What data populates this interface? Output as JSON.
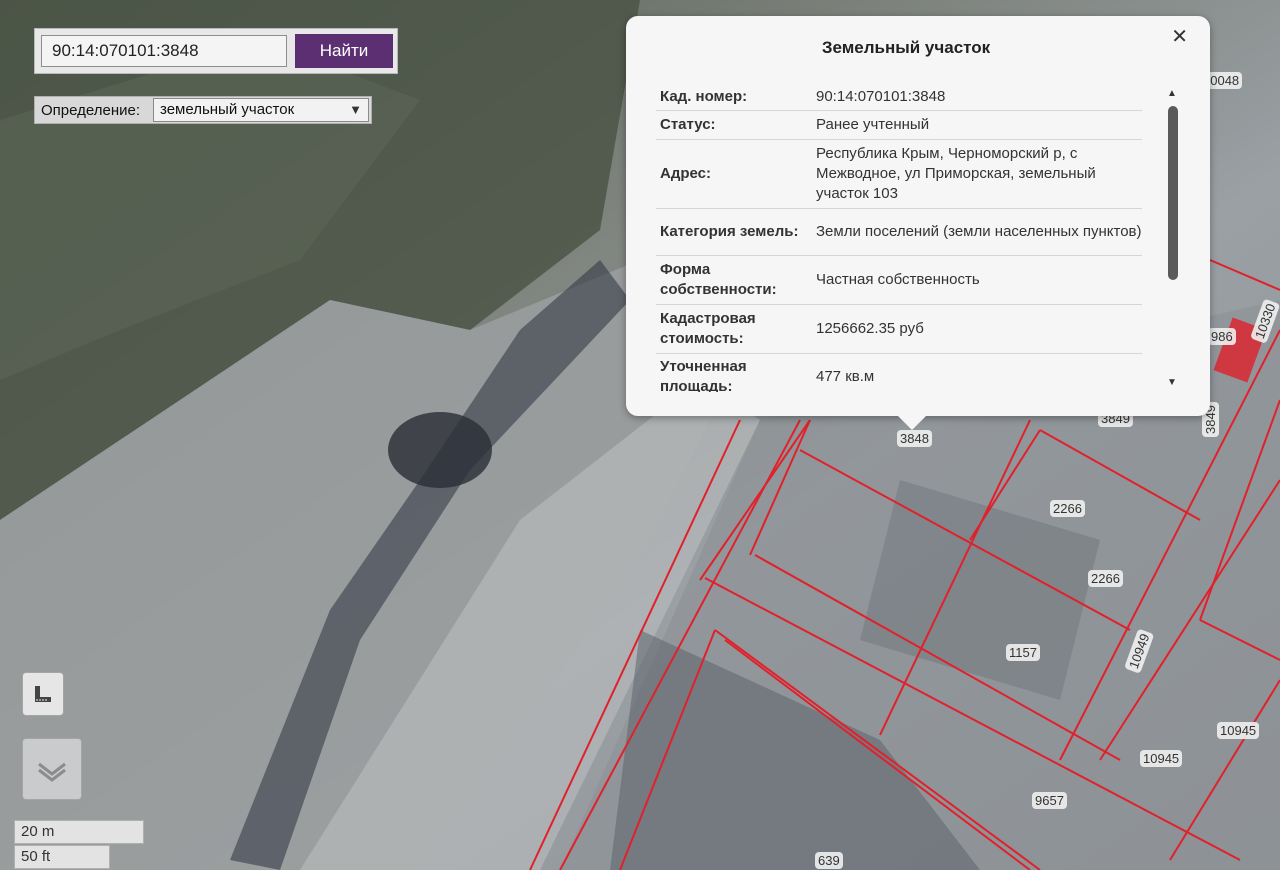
{
  "search": {
    "value": "90:14:070101:3848",
    "button_label": "Найти"
  },
  "definition": {
    "label": "Определение:",
    "selected": "земельный участок"
  },
  "popup": {
    "title": "Земельный участок",
    "rows": [
      {
        "key": "Кад. номер:",
        "value": "90:14:070101:3848"
      },
      {
        "key": "Статус:",
        "value": "Ранее учтенный"
      },
      {
        "key": "Адрес:",
        "value": "Республика Крым, Черноморский р, с Межводное, ул Приморская, земельный участок 103"
      },
      {
        "key": "Категория земель:",
        "value": "Земли поселений (земли населенных пунктов)"
      },
      {
        "key": "Форма собственности:",
        "value": "Частная собственность"
      },
      {
        "key": "Кадастровая стоимость:",
        "value": "1256662.35 руб"
      },
      {
        "key": "Уточненная площадь:",
        "value": "477 кв.м"
      }
    ]
  },
  "map_labels": [
    "10048",
    "986",
    "10330",
    "3849",
    "3849",
    "3848",
    "2266",
    "2266",
    "1157",
    "10949",
    "10945",
    "10945",
    "9657",
    "639"
  ],
  "scale": {
    "metric": "20 m",
    "imperial": "50 ft"
  },
  "icons": {
    "ruler": "ruler-icon",
    "layers": "layers-icon",
    "close": "close-icon"
  },
  "colors": {
    "parcel_border": "#e0212b",
    "button": "#5b2f72"
  }
}
